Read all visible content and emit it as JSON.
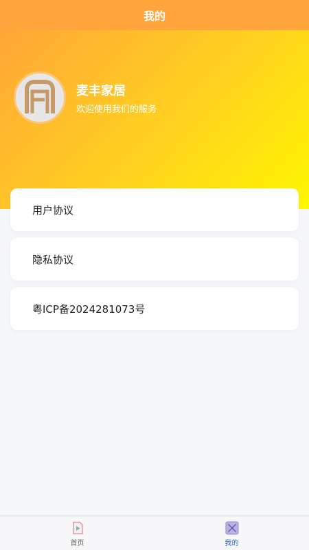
{
  "header": {
    "title": "我的"
  },
  "profile": {
    "name": "麦丰家居",
    "subtitle": "欢迎使用我们的服务",
    "avatar_icon": "brand-logo-icon"
  },
  "menu": {
    "items": [
      {
        "label": "用户协议"
      },
      {
        "label": "隐私协议"
      },
      {
        "label": "粤ICP备2024281073号"
      }
    ]
  },
  "tabbar": {
    "items": [
      {
        "label": "首页",
        "icon": "home-play-icon",
        "active": false
      },
      {
        "label": "我的",
        "icon": "profile-grid-icon",
        "active": true
      }
    ]
  },
  "colors": {
    "nav": "#ffa53c",
    "gradient_start": "#ffa637",
    "gradient_end": "#fff600",
    "active_tab": "#2a63d6",
    "background": "#f6f7fb"
  }
}
